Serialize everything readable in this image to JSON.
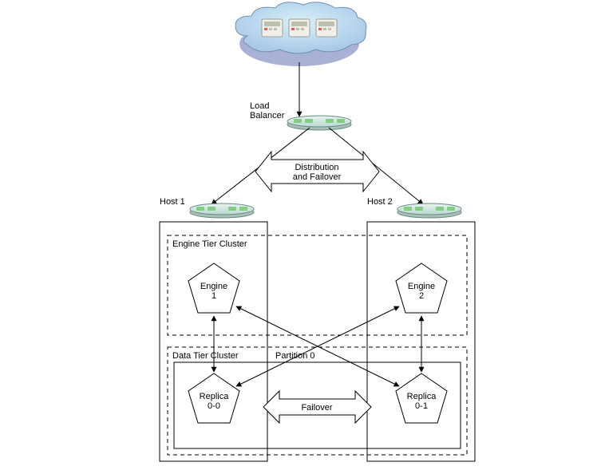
{
  "labels": {
    "loadBalancer": "Load",
    "loadBalancer2": "Balancer",
    "distFail1": "Distribution",
    "distFail2": "and Failover",
    "host1": "Host 1",
    "host2": "Host 2",
    "engineTier": "Engine Tier Cluster",
    "dataTier": "Data Tier Cluster",
    "partition": "Partition 0",
    "engine1a": "Engine",
    "engine1b": "1",
    "engine2a": "Engine",
    "engine2b": "2",
    "replica00a": "Replica",
    "replica00b": "0-0",
    "replica01a": "Replica",
    "replica01b": "0-1",
    "failover": "Failover"
  }
}
